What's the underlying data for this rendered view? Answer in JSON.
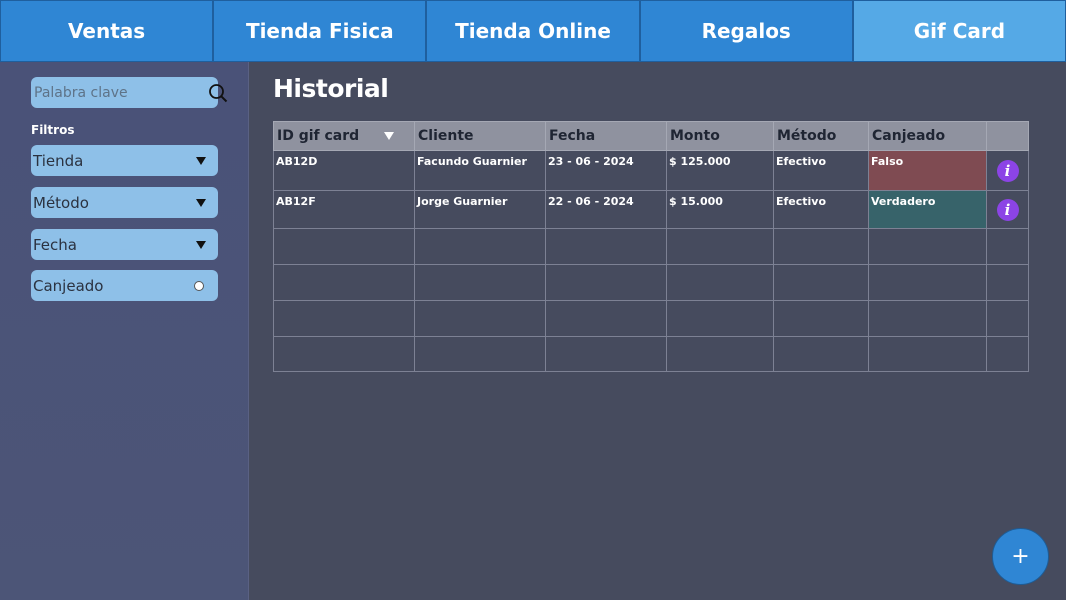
{
  "tabs": [
    {
      "label": "Ventas"
    },
    {
      "label": "Tienda Fisica"
    },
    {
      "label": "Tienda Online"
    },
    {
      "label": "Regalos"
    },
    {
      "label": "Gif Card"
    }
  ],
  "active_tab": "Gif Card",
  "sidebar": {
    "search": {
      "placeholder": "Palabra clave",
      "icon": "search-icon"
    },
    "filters_label": "Filtros",
    "filters": [
      {
        "label": "Tienda",
        "icon": "chevron-down-icon"
      },
      {
        "label": "Método",
        "icon": "chevron-down-icon"
      },
      {
        "label": "Fecha",
        "icon": "chevron-down-icon"
      },
      {
        "label": "Canjeado",
        "icon": "radio-icon"
      }
    ]
  },
  "main": {
    "title": "Historial",
    "table": {
      "columns": [
        "ID gif card",
        "Cliente",
        "Fecha",
        "Monto",
        "Método",
        "Canjeado",
        ""
      ],
      "rows": [
        {
          "id": "AB12D",
          "cliente": "Facundo Guarnier",
          "fecha": "23 - 06 - 2024",
          "monto": "$ 125.000",
          "metodo": "Efectivo",
          "canjeado": "Falso"
        },
        {
          "id": "AB12F",
          "cliente": "Jorge Guarnier",
          "fecha": "22 - 06 - 2024",
          "monto": "$ 15.000",
          "metodo": "Efectivo",
          "canjeado": "Verdadero"
        }
      ]
    },
    "add_button": "+"
  },
  "colors": {
    "tab": "#2f86d4",
    "tab_active": "#55a9e6",
    "canjeado_false": "#7f4b52",
    "canjeado_true": "#37636a",
    "info_button": "#8c44e6"
  }
}
